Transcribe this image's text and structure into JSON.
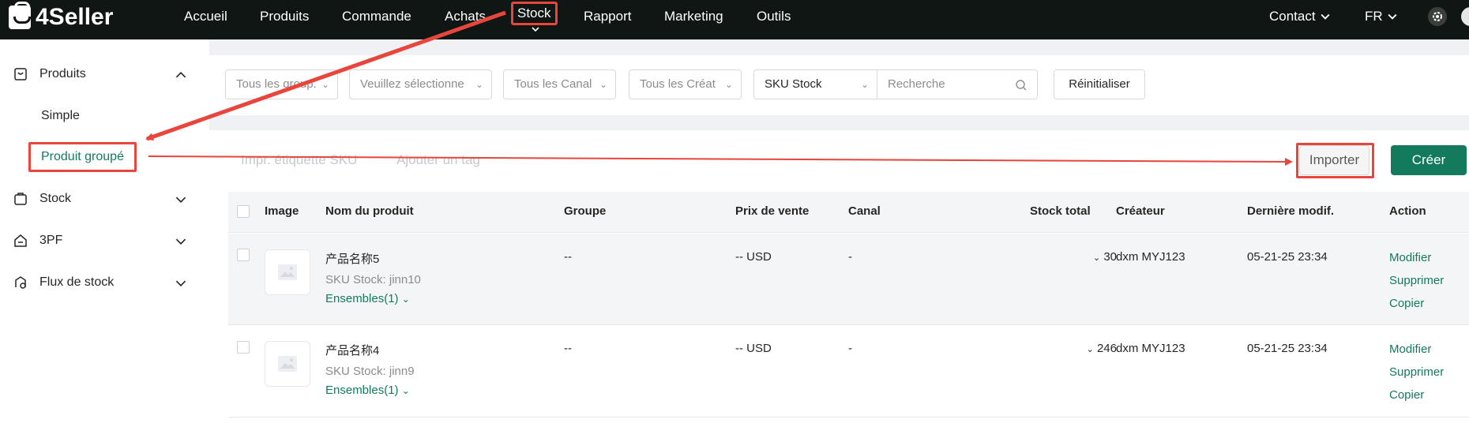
{
  "brand": {
    "name": "4Seller"
  },
  "nav": {
    "items": [
      {
        "label": "Accueil"
      },
      {
        "label": "Produits"
      },
      {
        "label": "Commande"
      },
      {
        "label": "Achats"
      },
      {
        "label": "Stock"
      },
      {
        "label": "Rapport"
      },
      {
        "label": "Marketing"
      },
      {
        "label": "Outils"
      }
    ],
    "active": "Stock",
    "contact": "Contact",
    "lang": "FR"
  },
  "sidebar": {
    "groups": [
      {
        "label": "Produits",
        "icon": "product-icon",
        "expanded": true
      },
      {
        "label": "Stock",
        "icon": "stock-icon",
        "expanded": false
      },
      {
        "label": "3PF",
        "icon": "warehouse-icon",
        "expanded": false
      },
      {
        "label": "Flux de stock",
        "icon": "flow-icon",
        "expanded": false
      }
    ],
    "sub_items": [
      {
        "label": "Simple"
      },
      {
        "label": "Produit groupé",
        "active": true
      }
    ]
  },
  "filters": {
    "group": "Tous les group.",
    "select": "Veuillez sélectionne",
    "channel": "Tous les Canal",
    "creator": "Tous les Créat",
    "sku_type": "SKU Stock",
    "search_placeholder": "Recherche",
    "reset": "Réinitialiser"
  },
  "toolbar": {
    "print_label": "Impr. étiquette SKU",
    "add_tag": "Ajouter un tag",
    "import": "Importer",
    "create": "Créer"
  },
  "table": {
    "headers": {
      "image": "Image",
      "name": "Nom du produit",
      "group": "Groupe",
      "price": "Prix de vente",
      "channel": "Canal",
      "stock": "Stock total",
      "creator": "Créateur",
      "modified": "Dernière modif.",
      "action": "Action"
    },
    "rows": [
      {
        "name": "产品名称5",
        "sku": "SKU Stock: jinn10",
        "bundles": "Ensembles(1)",
        "group": "--",
        "price": "-- USD",
        "channel": "-",
        "stock": "30",
        "creator": "dxm MYJ123",
        "modified": "05-21-25 23:34",
        "actions": [
          "Modifier",
          "Supprimer",
          "Copier"
        ]
      },
      {
        "name": "产品名称4",
        "sku": "SKU Stock: jinn9",
        "bundles": "Ensembles(1)",
        "group": "--",
        "price": "-- USD",
        "channel": "-",
        "stock": "246",
        "creator": "dxm MYJ123",
        "modified": "05-21-25 23:34",
        "actions": [
          "Modifier",
          "Supprimer",
          "Copier"
        ]
      }
    ]
  },
  "colors": {
    "topbar": "#101613",
    "accent": "#137a5e",
    "highlight": "#e8453c"
  }
}
